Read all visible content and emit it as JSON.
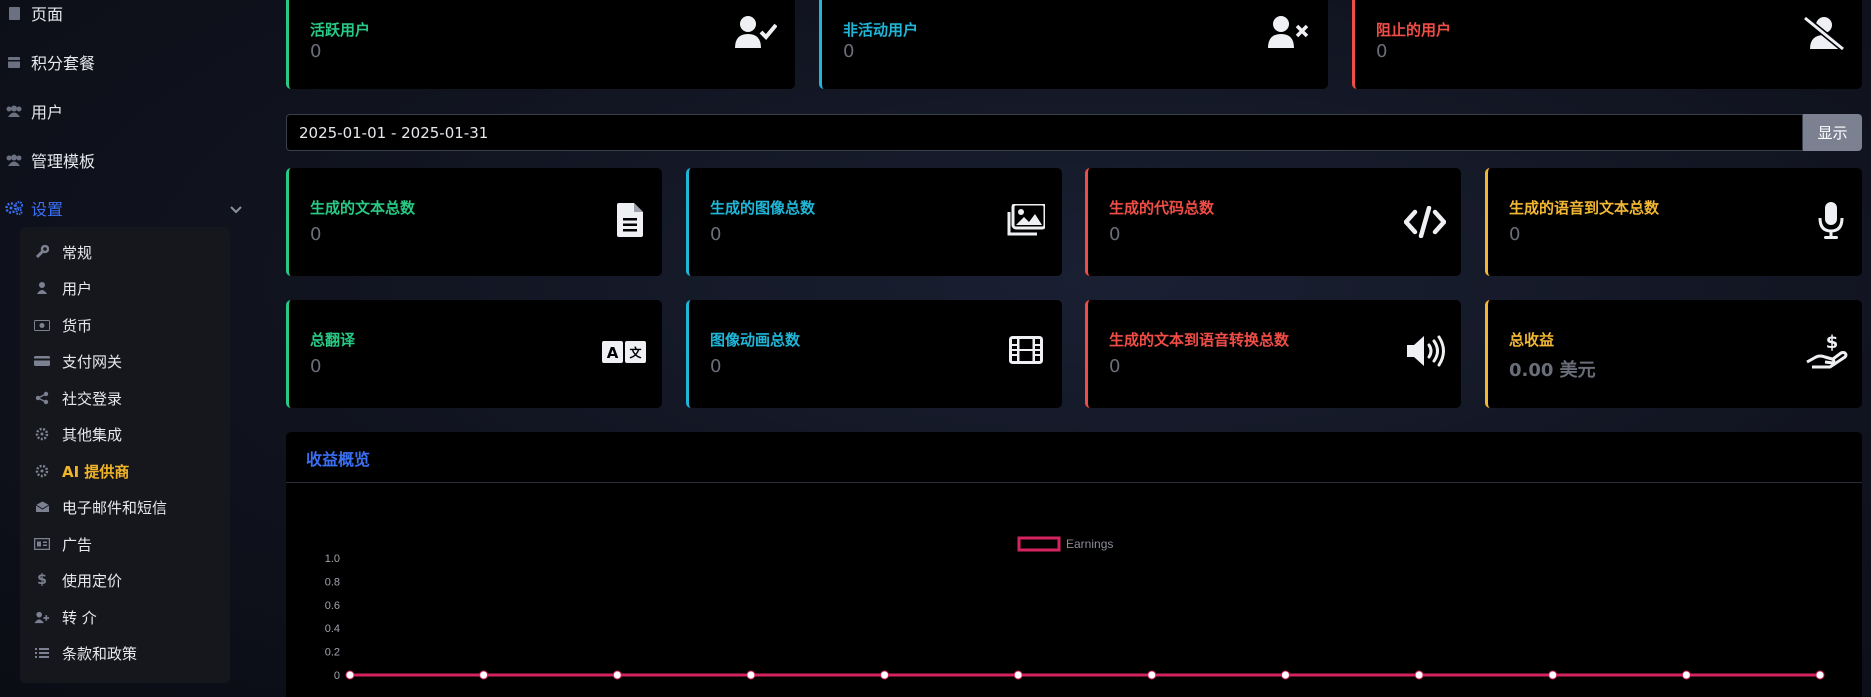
{
  "sidebar": {
    "items": [
      {
        "label": "页面",
        "icon": "page-icon"
      },
      {
        "label": "积分套餐",
        "icon": "package-icon"
      },
      {
        "label": "用户",
        "icon": "users-icon"
      },
      {
        "label": "管理模板",
        "icon": "templates-icon"
      },
      {
        "label": "设置",
        "icon": "gears-icon",
        "active": true
      }
    ],
    "submenu": [
      {
        "label": "常规",
        "icon": "wrench-icon"
      },
      {
        "label": "用户",
        "icon": "user-icon"
      },
      {
        "label": "货币",
        "icon": "money-icon"
      },
      {
        "label": "支付网关",
        "icon": "credit-card-icon"
      },
      {
        "label": "社交登录",
        "icon": "share-icon"
      },
      {
        "label": "其他集成",
        "icon": "cog-icon"
      },
      {
        "label": "AI 提供商",
        "icon": "cog-icon",
        "active": true
      },
      {
        "label": "电子邮件和短信",
        "icon": "envelope-icon"
      },
      {
        "label": "广告",
        "icon": "ad-icon"
      },
      {
        "label": "使用定价",
        "icon": "dollar-icon"
      },
      {
        "label": "转 介",
        "icon": "user-plus-icon"
      },
      {
        "label": "条款和政策",
        "icon": "list-icon"
      }
    ]
  },
  "top_cards": [
    {
      "label": "活跃用户",
      "value": "0",
      "icon": "user-check-icon"
    },
    {
      "label": "非活动用户",
      "value": "0",
      "icon": "user-times-icon"
    },
    {
      "label": "阻止的用户",
      "value": "0",
      "icon": "user-slash-icon"
    }
  ],
  "daterange": {
    "value": "2025-01-01 - 2025-01-31",
    "button": "显示"
  },
  "stat_cards_row1": [
    {
      "label": "生成的文本总数",
      "value": "0",
      "icon": "file-text-icon"
    },
    {
      "label": "生成的图像总数",
      "value": "0",
      "icon": "images-icon"
    },
    {
      "label": "生成的代码总数",
      "value": "0",
      "icon": "code-icon"
    },
    {
      "label": "生成的语音到文本总数",
      "value": "0",
      "icon": "microphone-icon"
    }
  ],
  "stat_cards_row2": [
    {
      "label": "总翻译",
      "value": "0",
      "icon": "translate-icon"
    },
    {
      "label": "图像动画总数",
      "value": "0",
      "icon": "film-icon"
    },
    {
      "label": "生成的文本到语音转换总数",
      "value": "0",
      "icon": "volume-icon"
    },
    {
      "label": "总收益",
      "value": "0.00 美元",
      "icon": "hand-dollar-icon"
    }
  ],
  "chart_panel": {
    "title": "收益概览"
  },
  "chart_data": {
    "type": "line",
    "legend_position": "top-center",
    "series": [
      {
        "name": "Earnings",
        "color": "#d6235f",
        "values": [
          0,
          0,
          0,
          0,
          0,
          0,
          0,
          0,
          0,
          0,
          0,
          0
        ]
      }
    ],
    "y_ticks": [
      "1.0",
      "0.8",
      "0.6",
      "0.4",
      "0.2",
      "0"
    ],
    "ylim": [
      0,
      1
    ],
    "grid": false
  },
  "colors": {
    "green": "#27c984",
    "cyan": "#1fb6d8",
    "red": "#ef4d47",
    "yellow": "#f2b733",
    "accent": "#3a6ff2"
  }
}
